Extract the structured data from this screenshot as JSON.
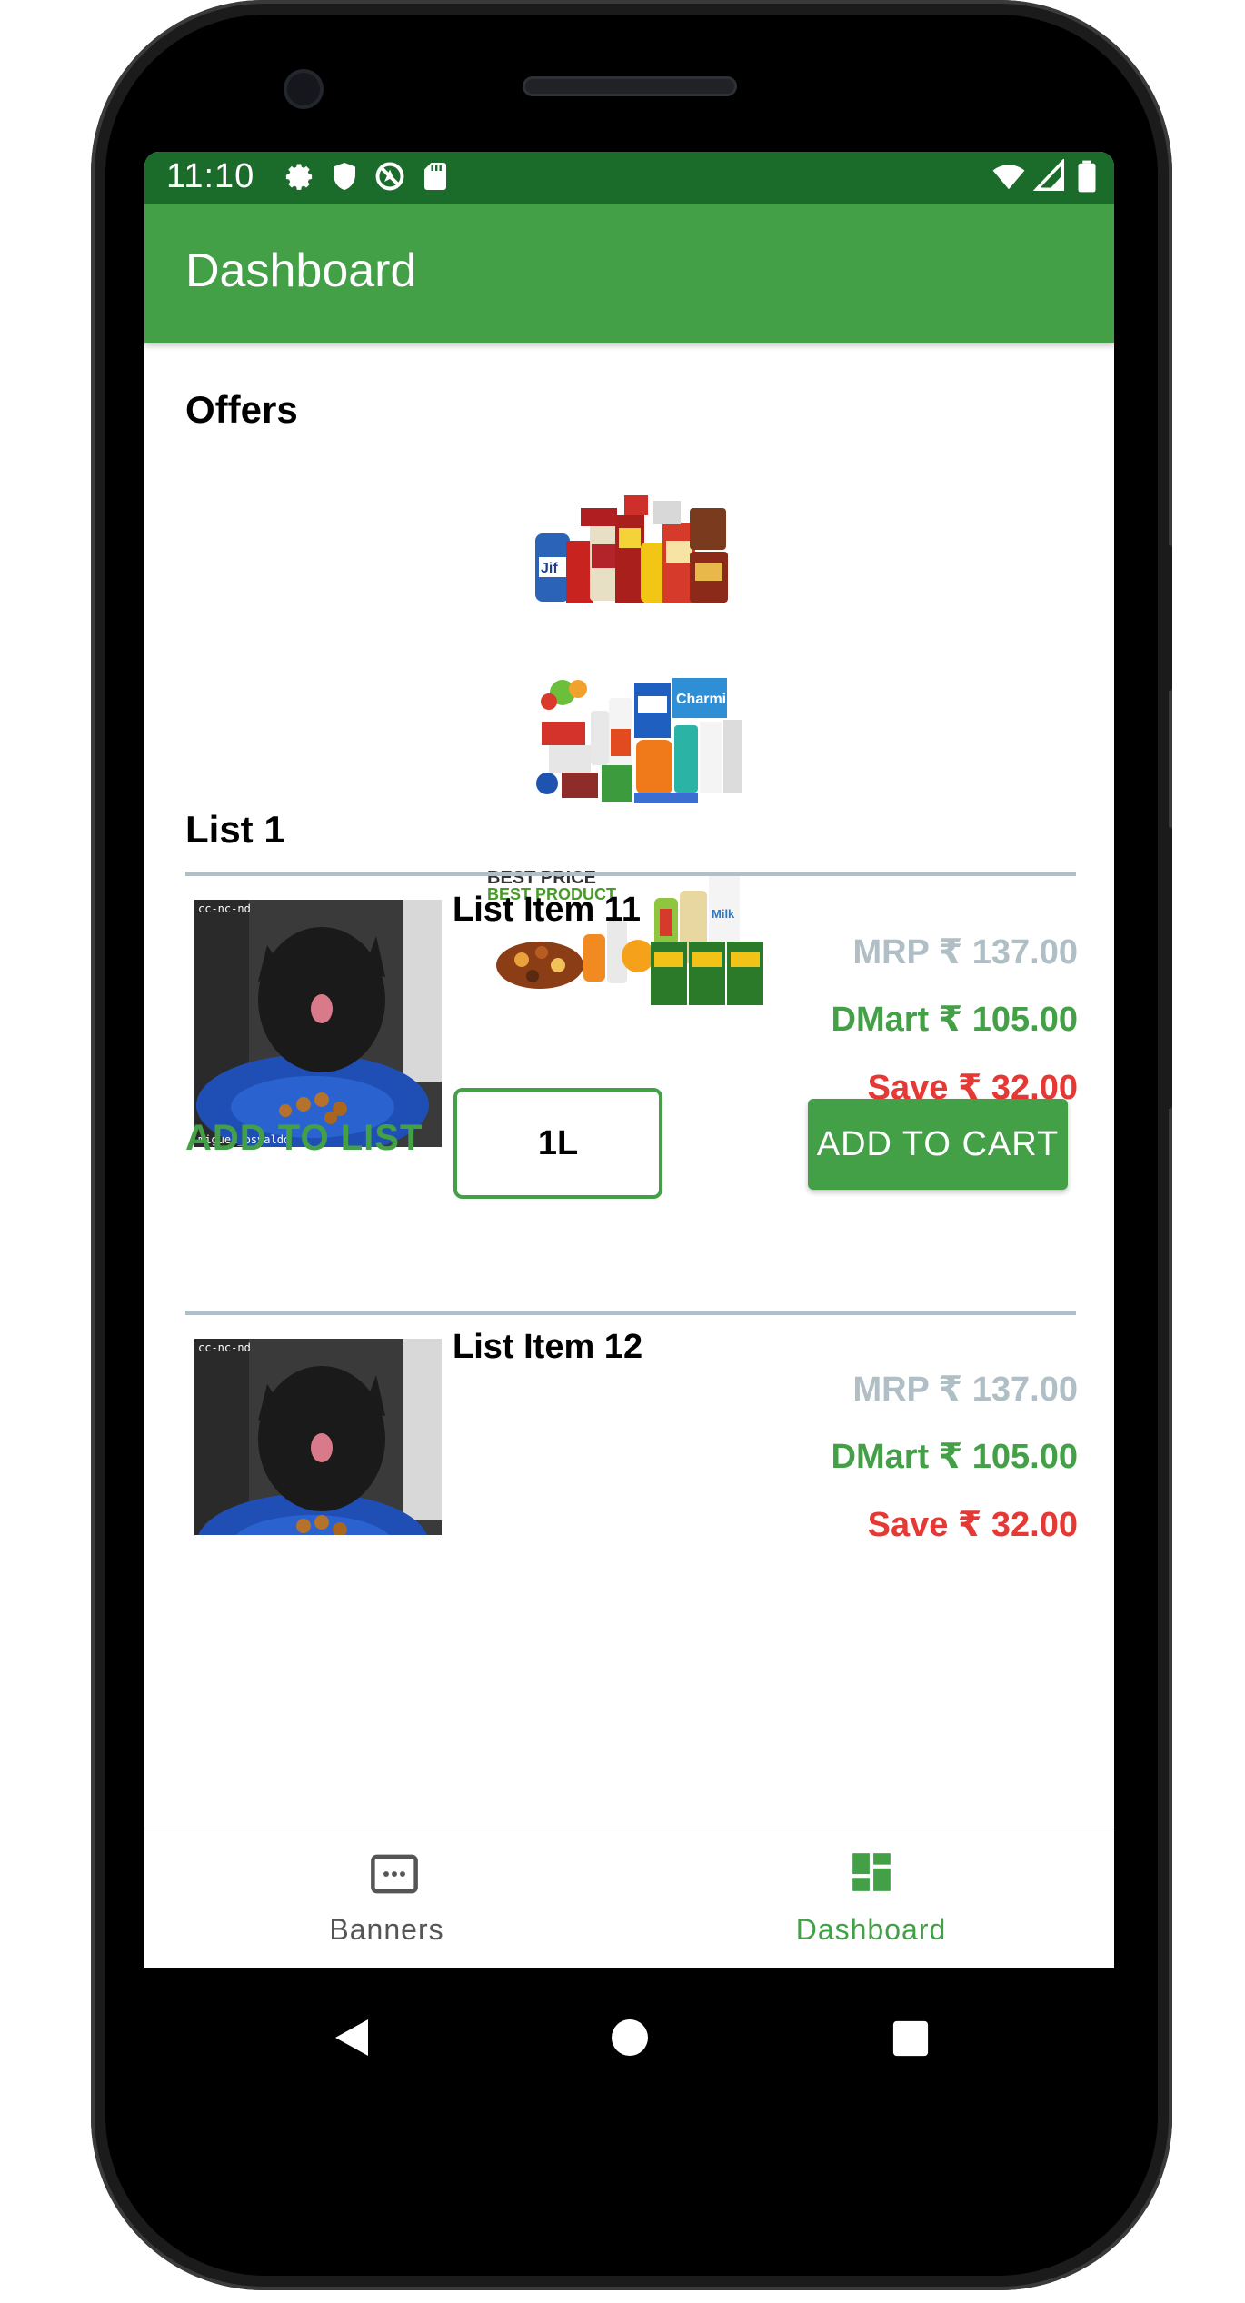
{
  "status_bar": {
    "time": "11:10",
    "left_icons": [
      "settings-icon",
      "shield-icon",
      "no-location-icon",
      "sd-card-icon"
    ],
    "right_icons": [
      "wifi-icon",
      "signal-icon",
      "battery-icon"
    ]
  },
  "app_bar": {
    "title": "Dashboard",
    "color": "#43a047",
    "status_color": "#1b6b2b"
  },
  "offers": {
    "title": "Offers",
    "banners": [
      "grocery-banner-1",
      "grocery-banner-2",
      "grocery-banner-3"
    ],
    "banner3_text": [
      "BEST PRICE",
      "BEST PRODUCT"
    ]
  },
  "list": {
    "title": "List 1",
    "items": [
      {
        "title": "List Item 11",
        "image_caption_top": "cc-nc-nd",
        "image_caption_bottom": "miguel_osvaldo",
        "mrp": "MRP ₹ 137.00",
        "dmart": "DMart ₹ 105.00",
        "save": "Save ₹ 32.00",
        "add_to_list": "ADD TO LIST",
        "quantity": "1L",
        "add_to_cart": "ADD TO CART"
      },
      {
        "title": "List Item 12",
        "image_caption_top": "cc-nc-nd",
        "mrp": "MRP ₹ 137.00",
        "dmart": "DMart ₹ 105.00",
        "save": "Save ₹ 32.00"
      }
    ]
  },
  "bottom_nav": {
    "items": [
      {
        "label": "Banners",
        "icon": "banner-icon",
        "active": false
      },
      {
        "label": "Dashboard",
        "icon": "dashboard-icon",
        "active": true
      }
    ]
  },
  "system_nav": [
    "back-icon",
    "home-icon",
    "recents-icon"
  ],
  "colors": {
    "accent": "#43a047",
    "mrp": "#b0bec5",
    "save": "#e53935"
  }
}
